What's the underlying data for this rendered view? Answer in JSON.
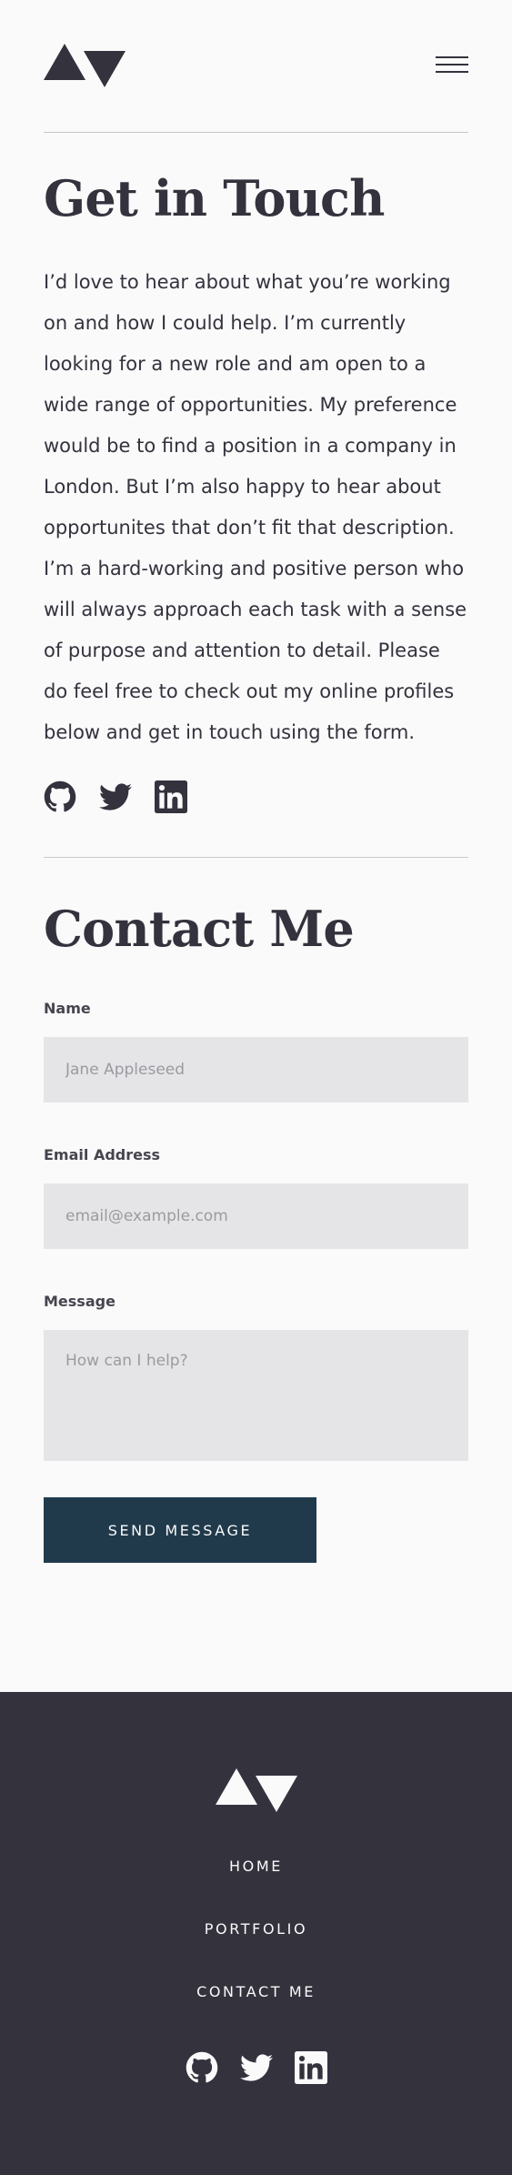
{
  "header": {
    "logo_icon": "logo-triangles-icon",
    "menu_icon": "hamburger-menu-icon"
  },
  "hero": {
    "title": "Get in Touch",
    "body": "I’d love to hear about what you’re working on and how I could help. I’m currently looking for a new role and am open to a wide range of opportunities. My preference would be to find a position in a company in London. But I’m also happy to hear about opportunites that don’t fit that description. I’m a hard-working and positive person who will always approach each task with a sense of purpose and attention to detail. Please do feel free to check out my online profiles below and get in touch using the form.",
    "social": [
      "github-icon",
      "twitter-icon",
      "linkedin-icon"
    ]
  },
  "contact": {
    "title": "Contact Me",
    "name_label": "Name",
    "name_placeholder": "Jane Appleseed",
    "email_label": "Email Address",
    "email_placeholder": "email@example.com",
    "message_label": "Message",
    "message_placeholder": "How can I help?",
    "send_label": "SEND MESSAGE"
  },
  "footer": {
    "nav": [
      "HOME",
      "PORTFOLIO",
      "CONTACT ME"
    ],
    "social": [
      "github-icon",
      "twitter-icon",
      "linkedin-icon"
    ]
  },
  "colors": {
    "background": "#fafafa",
    "text": "#33323d",
    "input_bg": "#e5e5e7",
    "button_bg": "#203a4c",
    "footer_bg": "#33323d"
  }
}
